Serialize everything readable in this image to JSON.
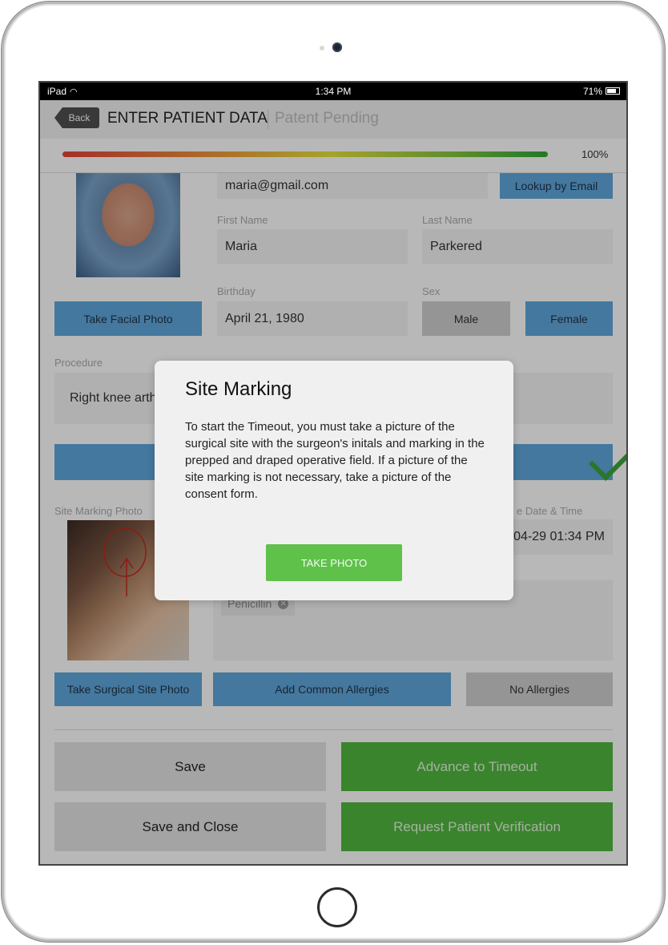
{
  "status_bar": {
    "device": "iPad",
    "time": "1:34 PM",
    "battery": "71%"
  },
  "nav": {
    "back_label": "Back",
    "title": "ENTER PATIENT DATA",
    "subtitle": "Patent Pending"
  },
  "progress": {
    "value": 1.0,
    "label": "100%"
  },
  "patient": {
    "email": "maria@gmail.com",
    "lookup_label": "Lookup by Email",
    "first_name_label": "First Name",
    "first_name": "Maria",
    "last_name_label": "Last Name",
    "last_name": "Parkered",
    "birthday_label": "Birthday",
    "birthday": "April 21, 1980",
    "sex_label": "Sex",
    "sex_options": [
      "Male",
      "Female"
    ],
    "take_facial_photo": "Take Facial Photo"
  },
  "procedure": {
    "label": "Procedure",
    "value": "Right knee arth"
  },
  "site_marking": {
    "label": "Site Marking Photo",
    "date_label": "e Date & Time",
    "date_value": "04-29 01:34 PM"
  },
  "allergies": {
    "tags": [
      "Penicillin"
    ]
  },
  "buttons": {
    "take_site_photo": "Take Surgical Site Photo",
    "add_allergies": "Add Common Allergies",
    "no_allergies": "No Allergies",
    "save": "Save",
    "advance": "Advance to Timeout",
    "save_close": "Save and Close",
    "request_verification": "Request Patient Verification"
  },
  "dialog": {
    "title": "Site Marking",
    "body": "To start the Timeout, you must take a picture of the surgical site with the surgeon's initals and marking in the prepped and draped operative field. If a picture of the site marking is not necessary, take a picture of the consent form.",
    "button": "TAKE PHOTO"
  }
}
